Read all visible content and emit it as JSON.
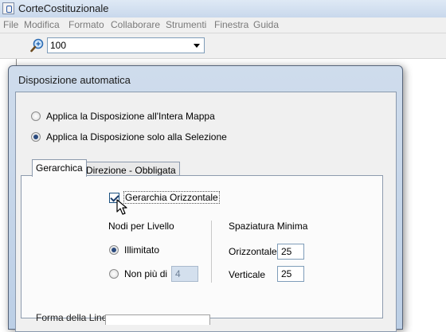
{
  "window": {
    "title": "CorteCostituzionale"
  },
  "menu": {
    "items": [
      "File",
      "Modifica",
      "Formato",
      "Collaborare",
      "Strumenti",
      "Finestra",
      "Guida"
    ]
  },
  "toolbar": {
    "zoom_value": "100"
  },
  "dialog": {
    "title": "Disposizione automatica",
    "scope_options": [
      {
        "label": "Applica la Disposizione all'Intera Mappa",
        "checked": false
      },
      {
        "label": "Applica la Disposizione solo alla Selezione",
        "checked": true
      }
    ],
    "tabs": [
      {
        "label": "Gerarchica",
        "active": true
      },
      {
        "label": "Direzione - Obbligata",
        "active": false
      }
    ],
    "hierarchy": {
      "checkbox_label": "Gerarchia Orizzontale",
      "checkbox_checked": true,
      "nodes_per_level_label": "Nodi per Livello",
      "unlimited_label": "Illimitato",
      "unlimited_checked": true,
      "max_label": "Non più di",
      "max_checked": false,
      "max_value": "4",
      "spacing_label": "Spaziatura Minima",
      "horizontal_label": "Orizzontale",
      "horizontal_value": "25",
      "vertical_label": "Verticale",
      "vertical_value": "25"
    },
    "line_shape_label": "Forma della Linea"
  }
}
